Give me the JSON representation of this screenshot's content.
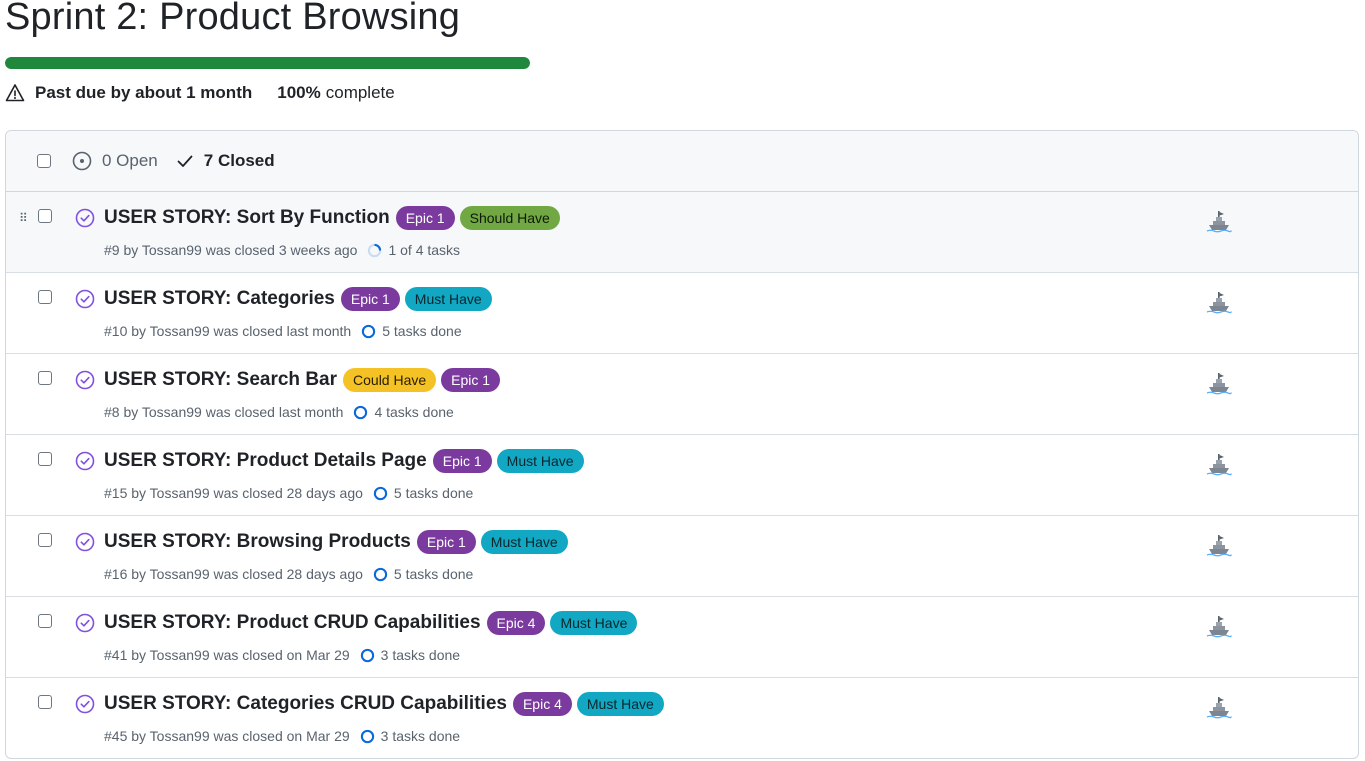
{
  "milestone": {
    "title": "Sprint 2: Product Browsing",
    "progress_percent": 100,
    "due_text": "Past due by about 1 month",
    "percent_label": "100%",
    "complete_label": "complete"
  },
  "states": {
    "open_label": "0 Open",
    "closed_label": "7 Closed"
  },
  "colors": {
    "progress": "#1f883d",
    "closed_purple": "#8250df"
  },
  "issues": [
    {
      "title": "USER STORY: Sort By Function",
      "labels": [
        {
          "name": "Epic 1",
          "bg": "#7b3a9e",
          "fg": "#ffffff"
        },
        {
          "name": "Should Have",
          "bg": "#72a843",
          "fg": "#0b1a05"
        }
      ],
      "meta": "#9 by Tossan99 was closed 3 weeks ago",
      "tasks": "1 of 4 tasks",
      "tasks_done": false
    },
    {
      "title": "USER STORY: Categories",
      "labels": [
        {
          "name": "Epic 1",
          "bg": "#7b3a9e",
          "fg": "#ffffff"
        },
        {
          "name": "Must Have",
          "bg": "#12a8c4",
          "fg": "#08262c"
        }
      ],
      "meta": "#10 by Tossan99 was closed last month",
      "tasks": "5 tasks done",
      "tasks_done": true
    },
    {
      "title": "USER STORY: Search Bar",
      "labels": [
        {
          "name": "Could Have",
          "bg": "#f5c226",
          "fg": "#2a2000"
        },
        {
          "name": "Epic 1",
          "bg": "#7b3a9e",
          "fg": "#ffffff"
        }
      ],
      "meta": "#8 by Tossan99 was closed last month",
      "tasks": "4 tasks done",
      "tasks_done": true
    },
    {
      "title": "USER STORY: Product Details Page",
      "labels": [
        {
          "name": "Epic 1",
          "bg": "#7b3a9e",
          "fg": "#ffffff"
        },
        {
          "name": "Must Have",
          "bg": "#12a8c4",
          "fg": "#08262c"
        }
      ],
      "meta": "#15 by Tossan99 was closed 28 days ago",
      "tasks": "5 tasks done",
      "tasks_done": true
    },
    {
      "title": "USER STORY: Browsing Products",
      "labels": [
        {
          "name": "Epic 1",
          "bg": "#7b3a9e",
          "fg": "#ffffff"
        },
        {
          "name": "Must Have",
          "bg": "#12a8c4",
          "fg": "#08262c"
        }
      ],
      "meta": "#16 by Tossan99 was closed 28 days ago",
      "tasks": "5 tasks done",
      "tasks_done": true
    },
    {
      "title": "USER STORY: Product CRUD Capabilities",
      "labels": [
        {
          "name": "Epic 4",
          "bg": "#7b3a9e",
          "fg": "#ffffff"
        },
        {
          "name": "Must Have",
          "bg": "#12a8c4",
          "fg": "#08262c"
        }
      ],
      "meta": "#41 by Tossan99 was closed on Mar 29",
      "tasks": "3 tasks done",
      "tasks_done": true
    },
    {
      "title": "USER STORY: Categories CRUD Capabilities",
      "labels": [
        {
          "name": "Epic 4",
          "bg": "#7b3a9e",
          "fg": "#ffffff"
        },
        {
          "name": "Must Have",
          "bg": "#12a8c4",
          "fg": "#08262c"
        }
      ],
      "meta": "#45 by Tossan99 was closed on Mar 29",
      "tasks": "3 tasks done",
      "tasks_done": true
    }
  ]
}
